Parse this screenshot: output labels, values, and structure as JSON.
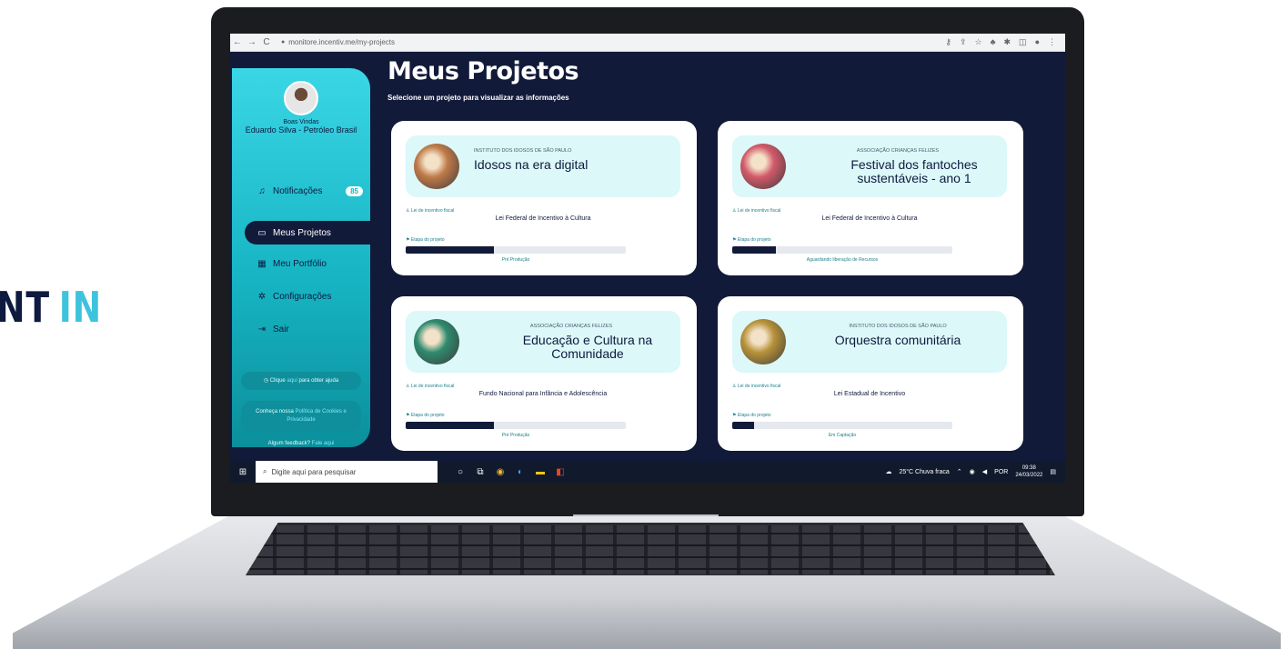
{
  "brand": {
    "word1": "NT",
    "word2": "IN"
  },
  "browser": {
    "url": "monitore.incentiv.me/my-projects",
    "back": "←",
    "forward": "→",
    "reload": "C"
  },
  "sidebar": {
    "welcome": "Boas Vindas",
    "user": "Eduardo Silva - Petróleo Brasil",
    "items": [
      {
        "label": "Notificações",
        "icon": "bell-icon",
        "glyph": "♫",
        "badge": "85"
      },
      {
        "label": "Meus Projetos",
        "icon": "folder-icon",
        "glyph": "▭"
      },
      {
        "label": "Meu Portfólio",
        "icon": "portfolio-icon",
        "glyph": "▦"
      },
      {
        "label": "Configurações",
        "icon": "gear-icon",
        "glyph": "✲"
      },
      {
        "label": "Sair",
        "icon": "exit-icon",
        "glyph": "⇥"
      }
    ],
    "help_prefix": "Clique",
    "help_link": "aqui",
    "help_suffix": "para obter ajuda",
    "privacy_prefix": "Conheça nossa",
    "privacy_link": "Política de Cookies e Privacidade",
    "feedback_prefix": "Algum feedback?",
    "feedback_link": "Fale aqui"
  },
  "main": {
    "title": "Meus Projetos",
    "subtitle": "Selecione um projeto para visualizar as informações",
    "law_label": "Lei de incentivo fiscal",
    "stage_label": "Etapa do projeto"
  },
  "projects": [
    {
      "org": "INSTITUTO DOS IDOSOS DE SÃO PAULO",
      "title": "Idosos na era digital",
      "law": "Lei Federal de Incentivo à Cultura",
      "stage": "Pré Produção",
      "progress": 0.4,
      "thumb_color": "#c07a48"
    },
    {
      "org": "ASSOCIAÇÃO CRIANÇAS FELIZES",
      "title": "Festival dos fantoches sustentáveis - ano 1",
      "law": "Lei Federal de Incentivo à Cultura",
      "stage": "Aguardando liberação de Recursos",
      "progress": 0.2,
      "thumb_color": "#d35a6a"
    },
    {
      "org": "ASSOCIAÇÃO CRIANÇAS FELIZES",
      "title": "Educação e Cultura na Comunidade",
      "law": "Fundo Nacional para Infância e Adolescência",
      "stage": "Pré Produção",
      "progress": 0.4,
      "thumb_color": "#2f8a6e"
    },
    {
      "org": "INSTITUTO DOS IDOSOS DE SÃO PAULO",
      "title": "Orquestra comunitária",
      "law": "Lei Estadual de Incentivo",
      "stage": "Em Captação",
      "progress": 0.1,
      "thumb_color": "#b8923a"
    }
  ],
  "taskbar": {
    "search_placeholder": "Digite aqui para pesquisar",
    "weather": "25°C  Chuva fraca",
    "lang": "POR",
    "time": "09:38",
    "date": "24/03/2022"
  }
}
